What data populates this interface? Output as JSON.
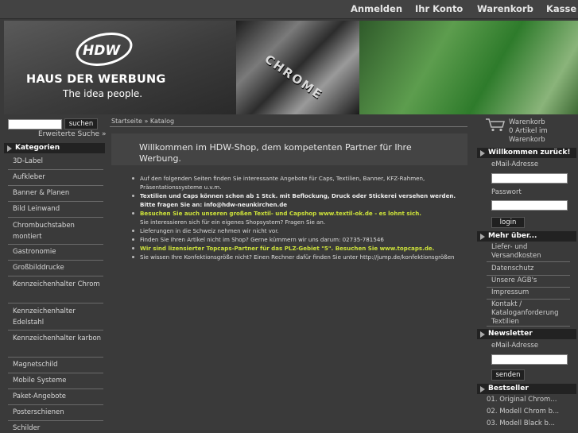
{
  "topnav": {
    "login": "Anmelden",
    "account": "Ihr Konto",
    "cart": "Warenkorb",
    "checkout": "Kasse"
  },
  "banner": {
    "logo": "HDW",
    "brand": "HAUS DER WERBUNG",
    "tagline": "The idea people.",
    "chrome": "CHROME"
  },
  "search": {
    "button": "suchen",
    "advanced": "Erweiterte Suche »"
  },
  "categories": {
    "title": "Kategorien",
    "items": [
      "3D-Label",
      "Aufkleber",
      "Banner & Planen",
      "Bild Leinwand",
      "Chrombuchstaben montiert",
      "Gastronomie",
      "Großbilddrucke",
      "Kennzeichenhalter Chrom",
      "Kennzeichenhalter Edelstahl",
      "Kennzeichenhalter karbon",
      "Magnetschild",
      "Mobile Systeme",
      "Paket-Angebote",
      "Posterschienen",
      "Schilder"
    ]
  },
  "breadcrumb": "Startseite » Katalog",
  "welcome": {
    "title": "Willkommen im HDW-Shop, dem kompetenten Partner für Ihre Werbung.",
    "bullets": [
      {
        "style": "normal",
        "text": "Auf den folgenden Seiten finden Sie interessante Angebote für Caps, Textilien, Banner, KFZ-Rahmen, Präsentationssysteme u.v.m."
      },
      {
        "style": "bold",
        "text": "Textilien und Caps können schon ab 1 Stck. mit Beflockung, Druck oder Stickerei versehen werden. Bitte fragen Sie an: info@hdw-neunkirchen.de"
      },
      {
        "style": "green",
        "text": "Besuchen Sie auch unseren großen Textil- und Capshop www.textil-ok.de - es lohnt sich.",
        "sub": "Sie interessieren sich für ein eigenes Shopsystem? Fragen Sie an."
      },
      {
        "style": "normal",
        "text": "Lieferungen in die Schweiz nehmen wir nicht vor."
      },
      {
        "style": "normal",
        "text": "Finden Sie Ihren Artikel nicht im Shop? Gerne kümmern wir uns darum: 02735-781546"
      },
      {
        "style": "green",
        "text": "Wir sind lizensierter Topcaps-Partner für das PLZ-Gebiet \"5\". Besuchen Sie www.topcaps.de."
      },
      {
        "style": "normal",
        "text": "Sie wissen Ihre Konfektionsgröße nicht? Einen Rechner dafür finden Sie unter http://jump.de/konfektionsgrößen"
      }
    ]
  },
  "cartbox": {
    "title": "Warenkorb",
    "count": "0 Artikel im",
    "suffix": "Warenkorb"
  },
  "loginbox": {
    "title": "Willkommen zurück!",
    "email_label": "eMail-Adresse",
    "password_label": "Passwort",
    "button": "login"
  },
  "about": {
    "title": "Mehr über...",
    "links": [
      "Liefer- und Versandkosten",
      "Datenschutz",
      "Unsere AGB's",
      "Impressum",
      "Kontakt / Kataloganforderung Textilien"
    ]
  },
  "newsletter": {
    "title": "Newsletter",
    "email_label": "eMail-Adresse",
    "button": "senden"
  },
  "bestseller": {
    "title": "Bestseller",
    "items": [
      "01. Original Chrom...",
      "02. Modell Chrom b...",
      "03. Modell Black b..."
    ]
  }
}
